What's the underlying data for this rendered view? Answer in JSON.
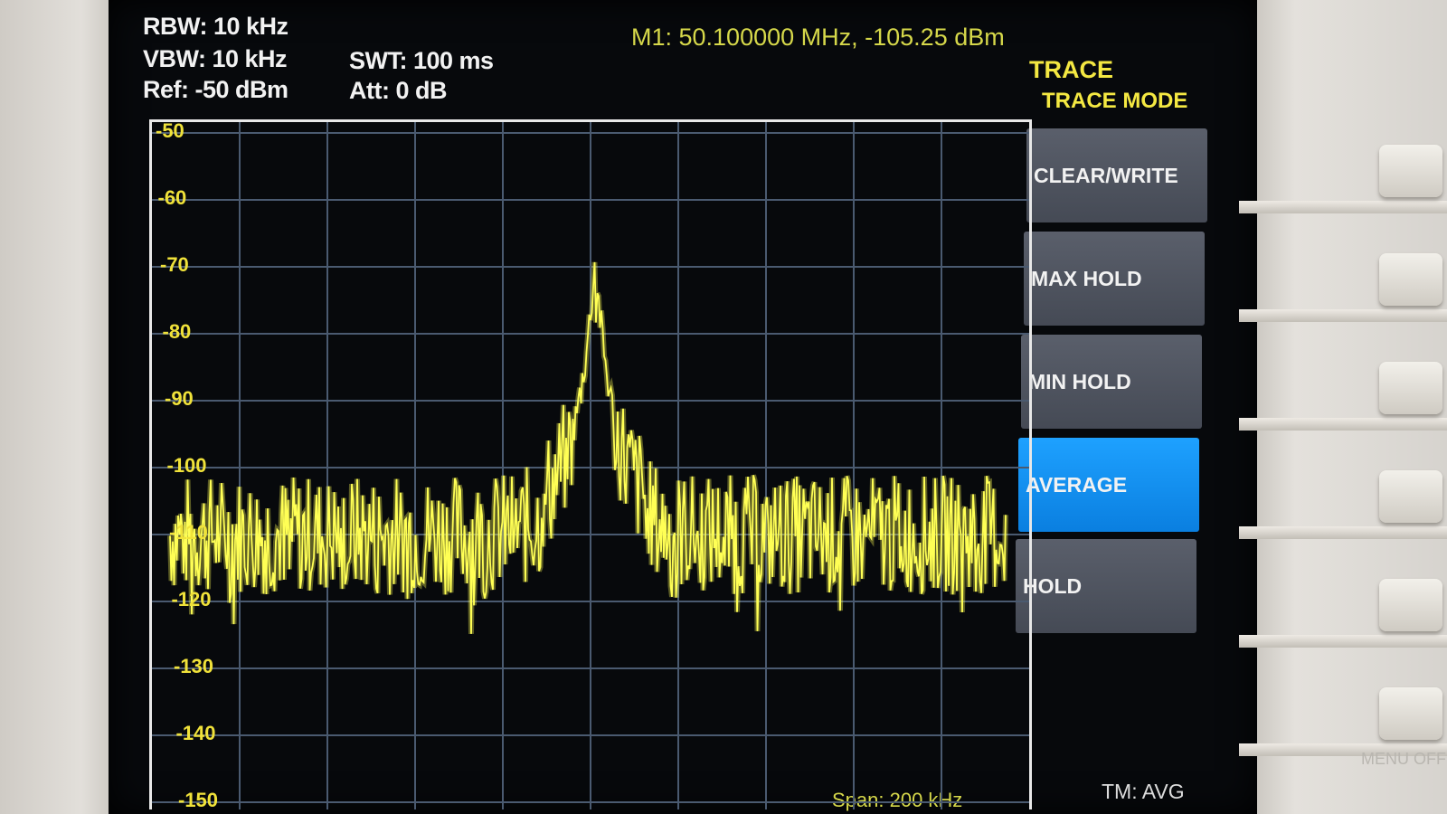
{
  "settings": {
    "rbw": "RBW: 10 kHz",
    "vbw": "VBW: 10 kHz",
    "ref": "Ref: -50 dBm",
    "swt": "SWT: 100 ms",
    "att": "Att: 0 dB"
  },
  "marker": "M1: 50.100000 MHz, -105.25 dBm",
  "menu": {
    "title": "TRACE",
    "subtitle": "TRACE MODE",
    "softkeys": [
      {
        "label": "CLEAR/WRITE",
        "active": false
      },
      {
        "label": "MAX HOLD",
        "active": false
      },
      {
        "label": "MIN HOLD",
        "active": false
      },
      {
        "label": "AVERAGE",
        "active": true
      },
      {
        "label": "HOLD",
        "active": false
      }
    ]
  },
  "status": {
    "trace_mode": "TM: AVG",
    "span": "Span: 200 kHz"
  },
  "hardware": {
    "menu_off": "MENU OFF"
  },
  "colors": {
    "trace": "#ffff55",
    "grid": "#4a5a70",
    "active_softkey": "#1b95f5",
    "axis_labels": "#f0e23a"
  },
  "chart_data": {
    "type": "line",
    "ylim": [
      -150,
      -50
    ],
    "y_tick_labels": [
      "-50",
      "-60",
      "-70",
      "-80",
      "-90",
      "-100",
      "-110",
      "-120",
      "-130",
      "-140",
      "-150"
    ],
    "ylabel_unit": "dBm",
    "grid": true,
    "noise_floor_dbm": -110,
    "peak": {
      "frequency_mhz": 50.1,
      "level_dbm": -69
    }
  }
}
